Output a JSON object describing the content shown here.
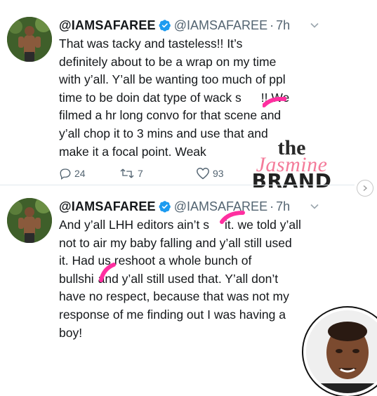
{
  "tweets": [
    {
      "display_name": "@IAMSAFAREE",
      "handle": "@IAMSAFAREE",
      "time": "7h",
      "lines": [
        "That was tacky and tasteless!! It’s",
        "definitely about to be a wrap on my time",
        "with y’all. Y’all be wanting too much of ppl",
        "time to be doin dat type of wack s",
        "!! We",
        "filmed a hr long convo for that scene and",
        "y’all chop it to 3 mins and use that and",
        "make it a focal point. Weak"
      ],
      "replies": "24",
      "retweets": "7",
      "likes": "93"
    },
    {
      "display_name": "@IAMSAFAREE",
      "handle": "@IAMSAFAREE",
      "time": "7h",
      "lines": [
        "And y’all LHH editors ain’t s",
        "it. we told y’all",
        "not to air my baby falling and y’all still used",
        "it. Had us reshoot a whole bunch of",
        "bullshi",
        "and y’all still used that. Y’all don’t",
        "have no respect, because that was not my",
        "response of me finding out I was having a",
        "boy!"
      ]
    }
  ],
  "watermark": {
    "line1": "the",
    "line2": "Jasmine",
    "line3": "BRAND"
  },
  "colors": {
    "verified": "#1d9bf0",
    "censor": "#ff2fa0",
    "divider": "#e1e8ed",
    "muted": "#536471"
  }
}
